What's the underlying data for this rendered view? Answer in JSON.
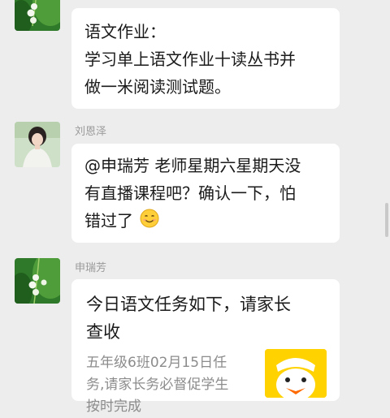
{
  "messages": [
    {
      "sender": "",
      "text_lines": [
        "语文作业：",
        "学习单上语文作业十读丛书并",
        "做一米阅读测试题。"
      ]
    },
    {
      "sender": "刘恩泽",
      "text_lines": [
        "@申瑞芳  老师星期六星期天没",
        "有直播课程吧？确认一下，怕",
        "错过了"
      ],
      "emoji": "smiling-face-icon"
    },
    {
      "sender": "申瑞芳",
      "link_card": {
        "title_lines": [
          "今日语文任务如下，请家长",
          "查收"
        ],
        "desc_lines": [
          "五年级6班02月15日任",
          "务,请家长务必督促学生",
          "按时完成"
        ]
      }
    }
  ],
  "colors": {
    "background": "#ededed",
    "bubble": "#ffffff",
    "thumb_bg": "#ffd200"
  }
}
